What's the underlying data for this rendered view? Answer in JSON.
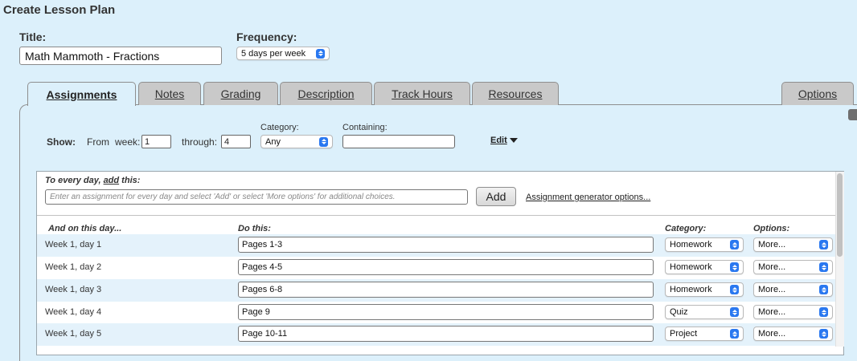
{
  "page": {
    "title": "Create Lesson Plan"
  },
  "form": {
    "title_label": "Title:",
    "title_value": "Math Mammoth - Fractions",
    "frequency_label": "Frequency:",
    "frequency_value": "5 days per week"
  },
  "tabs": [
    {
      "label": "Assignments",
      "active": true
    },
    {
      "label": "Notes"
    },
    {
      "label": "Grading"
    },
    {
      "label": "Description"
    },
    {
      "label": "Track Hours"
    },
    {
      "label": "Resources"
    },
    {
      "label": "Options"
    }
  ],
  "filters": {
    "show_label": "Show:",
    "from_label": "From",
    "week_label": "week:",
    "from_value": "1",
    "through_label": "through:",
    "through_value": "4",
    "category_label": "Category:",
    "category_value": "Any",
    "containing_label": "Containing:",
    "containing_value": "",
    "edit_label": "Edit"
  },
  "every_day": {
    "prefix": "To every day, ",
    "add_word": "add",
    "suffix": " this:",
    "placeholder": "Enter an assignment for every day and select 'Add' or select 'More options' for additional choices.",
    "add_button": "Add",
    "generator_link": "Assignment generator options..."
  },
  "table": {
    "headers": {
      "day": "And on this day...",
      "do_this": "Do this:",
      "category": "Category:",
      "options": "Options:"
    },
    "rows": [
      {
        "day": "Week 1, day 1",
        "task": "Pages 1-3",
        "category": "Homework",
        "option": "More..."
      },
      {
        "day": "Week 1, day 2",
        "task": "Pages 4-5",
        "category": "Homework",
        "option": "More..."
      },
      {
        "day": "Week 1, day 3",
        "task": "Pages 6-8",
        "category": "Homework",
        "option": "More..."
      },
      {
        "day": "Week 1, day 4",
        "task": "Page 9",
        "category": "Quiz",
        "option": "More..."
      },
      {
        "day": "Week 1, day 5",
        "task": "Page 10-11",
        "category": "Project",
        "option": "More..."
      }
    ]
  },
  "icons": {
    "dropdown": "chevron-updown-icon",
    "edit_menu": "caret-down-icon",
    "panel_expand": "expand-icon"
  },
  "colors": {
    "background": "#dcf0fb",
    "tab_inactive": "#c9c9c9",
    "row_alt": "#e4f2fb",
    "select_accent": "#2a78f0"
  }
}
